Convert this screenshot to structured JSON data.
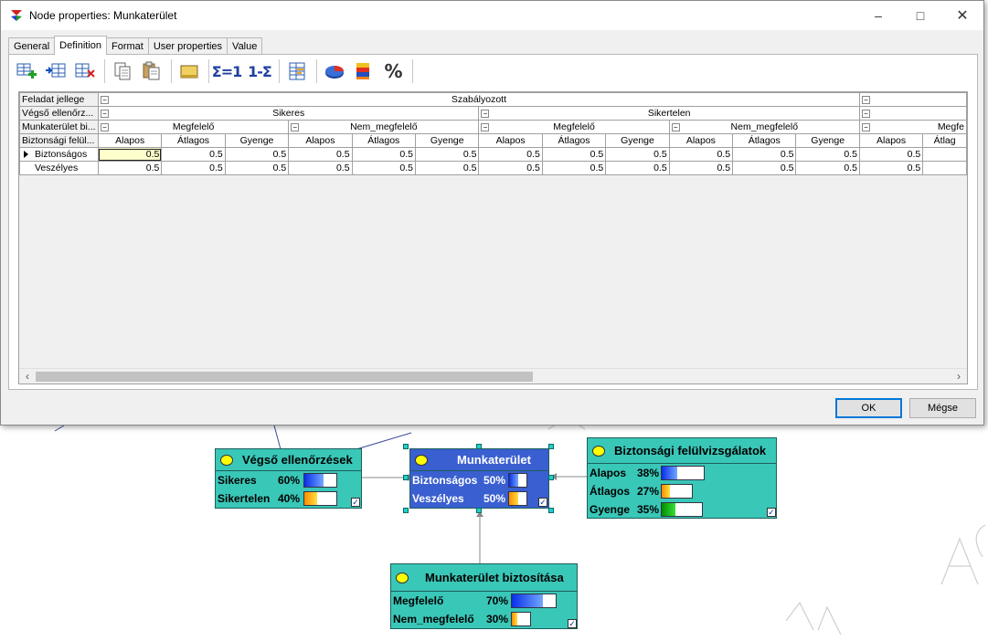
{
  "dialog": {
    "title": "Node properties: Munkaterület",
    "tabs": [
      "General",
      "Definition",
      "Format",
      "User properties",
      "Value"
    ],
    "active_tab": "Definition",
    "toolbar": {
      "sum1": "Σ=1",
      "one_minus_sum": "1-Σ",
      "percent": "%"
    },
    "ok_label": "OK",
    "cancel_label": "Mégse"
  },
  "table": {
    "row_headers": [
      "Feladat jellege",
      "Végső ellenőrz...",
      "Munkaterület bi...",
      "Biztonsági felül..."
    ],
    "level1": "Szabályozott",
    "level2": [
      "Sikeres",
      "Sikertelen"
    ],
    "level3": [
      "Megfelelő",
      "Nem_megfelelő",
      "Megfelelő",
      "Nem_megfelelő",
      "Megfe"
    ],
    "level4": [
      "Alapos",
      "Átlagos",
      "Gyenge",
      "Alapos",
      "Átlagos",
      "Gyenge",
      "Alapos",
      "Átlagos",
      "Gyenge",
      "Alapos",
      "Átlagos",
      "Gyenge",
      "Alapos",
      "Átlag"
    ],
    "rows": [
      {
        "label": "Biztonságos",
        "values": [
          "0.5",
          "0.5",
          "0.5",
          "0.5",
          "0.5",
          "0.5",
          "0.5",
          "0.5",
          "0.5",
          "0.5",
          "0.5",
          "0.5",
          "0.5",
          ""
        ]
      },
      {
        "label": "Veszélyes",
        "values": [
          "0.5",
          "0.5",
          "0.5",
          "0.5",
          "0.5",
          "0.5",
          "0.5",
          "0.5",
          "0.5",
          "0.5",
          "0.5",
          "0.5",
          "0.5",
          ""
        ]
      }
    ]
  },
  "nodes": {
    "vegso": {
      "title": "Végső ellenőrzések",
      "states": [
        {
          "label": "Sikeres",
          "pct": "60%",
          "value": 0.6,
          "color": "blue"
        },
        {
          "label": "Sikertelen",
          "pct": "40%",
          "value": 0.4,
          "color": "orange"
        }
      ]
    },
    "munkaterulet": {
      "title": "Munkaterület",
      "states": [
        {
          "label": "Biztonságos",
          "pct": "50%",
          "value": 0.5,
          "color": "blue"
        },
        {
          "label": "Veszélyes",
          "pct": "50%",
          "value": 0.5,
          "color": "orange"
        }
      ]
    },
    "biztonsagi": {
      "title": "Biztonsági felülvizsgálatok",
      "states": [
        {
          "label": "Alapos",
          "pct": "38%",
          "value": 0.38,
          "color": "blue"
        },
        {
          "label": "Átlagos",
          "pct": "27%",
          "value": 0.27,
          "color": "orange"
        },
        {
          "label": "Gyenge",
          "pct": "35%",
          "value": 0.35,
          "color": "green"
        }
      ]
    },
    "biztositasa": {
      "title": "Munkaterület biztosítása",
      "states": [
        {
          "label": "Megfelelő",
          "pct": "70%",
          "value": 0.7,
          "color": "blue"
        },
        {
          "label": "Nem_megfelelő",
          "pct": "30%",
          "value": 0.3,
          "color": "orange"
        }
      ]
    }
  },
  "colors": {
    "node_bg": "#39c7b8",
    "node_selected_bg": "#3a5fd0",
    "accent": "#0078d7"
  }
}
